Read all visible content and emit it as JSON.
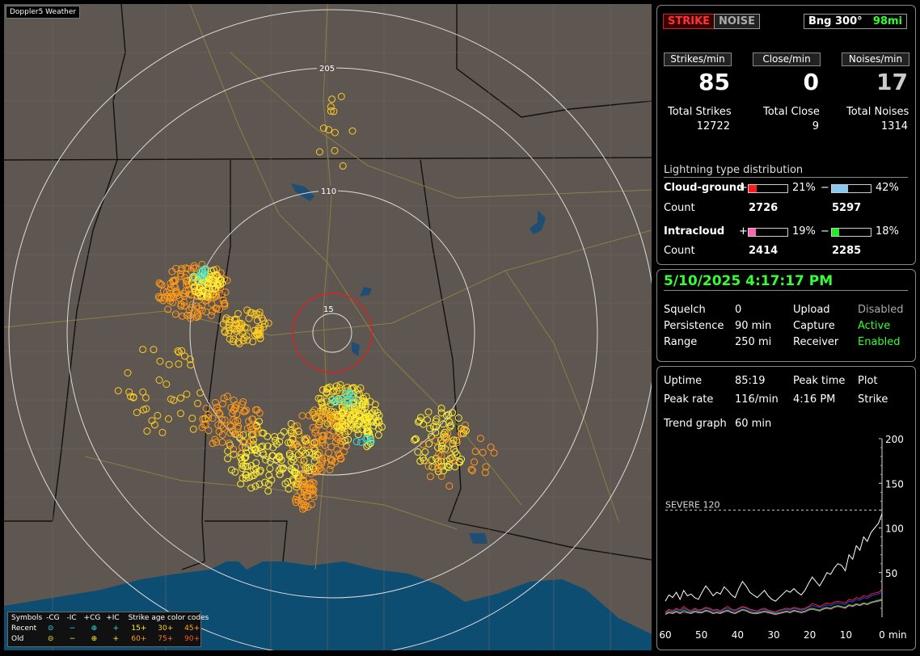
{
  "app_title": "Doppler5 Weather",
  "map": {
    "ring_labels": [
      "205",
      "110",
      "15"
    ]
  },
  "legend": {
    "row0": {
      "symbols": "Symbols",
      "mcg": "-CG",
      "mic": "-IC",
      "pcg": "+CG",
      "pic": "+IC",
      "age": "Strike age color codes"
    },
    "row1": {
      "label": "Recent",
      "a": "15+",
      "b": "30+",
      "c": "45+"
    },
    "row2": {
      "label": "Old",
      "a": "60+",
      "b": "75+",
      "c": "90+"
    }
  },
  "status": {
    "strike_tag": "STRIKE",
    "noise_tag": "NOISE",
    "bearing": "Bng 300°",
    "distance": "98mi",
    "strikes_min_label": "Strikes/min",
    "close_min_label": "Close/min",
    "noises_min_label": "Noises/min",
    "strikes_min": "85",
    "close_min": "0",
    "noises_min": "17",
    "total_strikes_label": "Total Strikes",
    "total_close_label": "Total Close",
    "total_noises_label": "Total Noises",
    "total_strikes": "12722",
    "total_close": "9",
    "total_noises": "1314"
  },
  "distribution": {
    "title": "Lightning type distribution",
    "cg_label": "Cloud-ground",
    "ic_label": "Intracloud",
    "count_label": "Count",
    "plus": "+",
    "minus": "−",
    "cg_pos_pct": "21%",
    "cg_neg_pct": "42%",
    "ic_pos_pct": "19%",
    "ic_neg_pct": "18%",
    "cg_pos_count": "2726",
    "cg_neg_count": "5297",
    "ic_pos_count": "2414",
    "ic_neg_count": "2285",
    "cg_pos_frac": 0.21,
    "cg_neg_frac": 0.42,
    "ic_pos_frac": 0.19,
    "ic_neg_frac": 0.18,
    "colors": {
      "cg_pos": "#ff1a1a",
      "cg_neg": "#87c8f0",
      "ic_pos": "#ff66b0",
      "ic_neg": "#22ee22"
    }
  },
  "info": {
    "datetime": "5/10/2025 4:17:17 PM",
    "squelch_label": "Squelch",
    "squelch": "0",
    "persistence_label": "Persistence",
    "persistence": "90 min",
    "range_label": "Range",
    "range": "250 mi",
    "upload_label": "Upload",
    "upload": "Disabled",
    "capture_label": "Capture",
    "capture": "Active",
    "receiver_label": "Receiver",
    "receiver": "Enabled"
  },
  "stats": {
    "uptime_label": "Uptime",
    "uptime": "85:19",
    "peak_time_label": "Peak time",
    "peak_time": "4:16 PM",
    "plot_label": "Plot",
    "plot": "Strike",
    "peak_rate_label": "Peak rate",
    "peak_rate": "116/min",
    "trend_label": "Trend graph",
    "trend": "60 min"
  },
  "chart_data": {
    "type": "line",
    "severe_label": "SEVERE 120",
    "severe_value": 120,
    "x_ticks": [
      "60",
      "50",
      "40",
      "30",
      "20",
      "10",
      "0"
    ],
    "x_unit": "min",
    "y_ticks": [
      "200",
      "150",
      "100",
      "50"
    ],
    "ylim": [
      0,
      200
    ],
    "xlim": [
      60,
      0
    ],
    "series": [
      {
        "color": "#ffffff",
        "values": [
          18,
          25,
          22,
          28,
          20,
          30,
          24,
          26,
          22,
          20,
          28,
          35,
          30,
          24,
          28,
          26,
          34,
          30,
          25,
          22,
          32,
          40,
          35,
          28,
          25,
          22,
          26,
          30,
          24,
          20,
          18,
          22,
          26,
          30,
          28,
          32,
          28,
          25,
          30,
          38,
          45,
          40,
          35,
          42,
          50,
          48,
          55,
          60,
          58,
          52,
          70,
          65,
          80,
          75,
          90,
          85,
          95,
          100,
          105,
          116
        ]
      },
      {
        "color": "#2244ff",
        "values": [
          5,
          8,
          6,
          9,
          7,
          10,
          8,
          6,
          9,
          7,
          8,
          10,
          9,
          7,
          8,
          6,
          9,
          10,
          8,
          7,
          9,
          11,
          10,
          8,
          7,
          6,
          8,
          9,
          7,
          6,
          5,
          7,
          8,
          9,
          8,
          10,
          9,
          8,
          9,
          11,
          13,
          12,
          11,
          12,
          14,
          13,
          15,
          16,
          15,
          14,
          18,
          17,
          20,
          19,
          22,
          21,
          24,
          25,
          26,
          28
        ]
      },
      {
        "color": "#ff2222",
        "values": [
          6,
          9,
          7,
          10,
          8,
          12,
          9,
          7,
          10,
          8,
          9,
          11,
          10,
          8,
          9,
          7,
          10,
          12,
          9,
          8,
          10,
          12,
          11,
          9,
          8,
          7,
          9,
          10,
          8,
          7,
          6,
          8,
          9,
          10,
          9,
          11,
          10,
          9,
          10,
          12,
          15,
          14,
          12,
          14,
          16,
          15,
          17,
          18,
          17,
          16,
          20,
          19,
          22,
          21,
          24,
          23,
          26,
          27,
          28,
          30
        ]
      },
      {
        "color": "#22ee22",
        "values": [
          4,
          6,
          5,
          7,
          5,
          8,
          6,
          5,
          7,
          6,
          6,
          8,
          7,
          5,
          6,
          5,
          7,
          8,
          6,
          5,
          7,
          9,
          8,
          6,
          5,
          5,
          6,
          7,
          6,
          5,
          4,
          5,
          6,
          7,
          6,
          8,
          7,
          6,
          7,
          9,
          10,
          9,
          8,
          10,
          11,
          10,
          12,
          13,
          12,
          11,
          14,
          13,
          15,
          14,
          16,
          15,
          17,
          18,
          19,
          20
        ]
      },
      {
        "color": "#ff66cc",
        "values": [
          3,
          5,
          4,
          6,
          4,
          6,
          5,
          4,
          6,
          5,
          5,
          7,
          6,
          4,
          5,
          4,
          6,
          7,
          5,
          4,
          6,
          8,
          7,
          5,
          4,
          4,
          5,
          6,
          5,
          4,
          3,
          4,
          5,
          6,
          5,
          7,
          6,
          5,
          6,
          8,
          9,
          8,
          7,
          9,
          10,
          9,
          11,
          12,
          11,
          10,
          13,
          12,
          14,
          13,
          15,
          14,
          16,
          17,
          18,
          19
        ]
      }
    ]
  }
}
